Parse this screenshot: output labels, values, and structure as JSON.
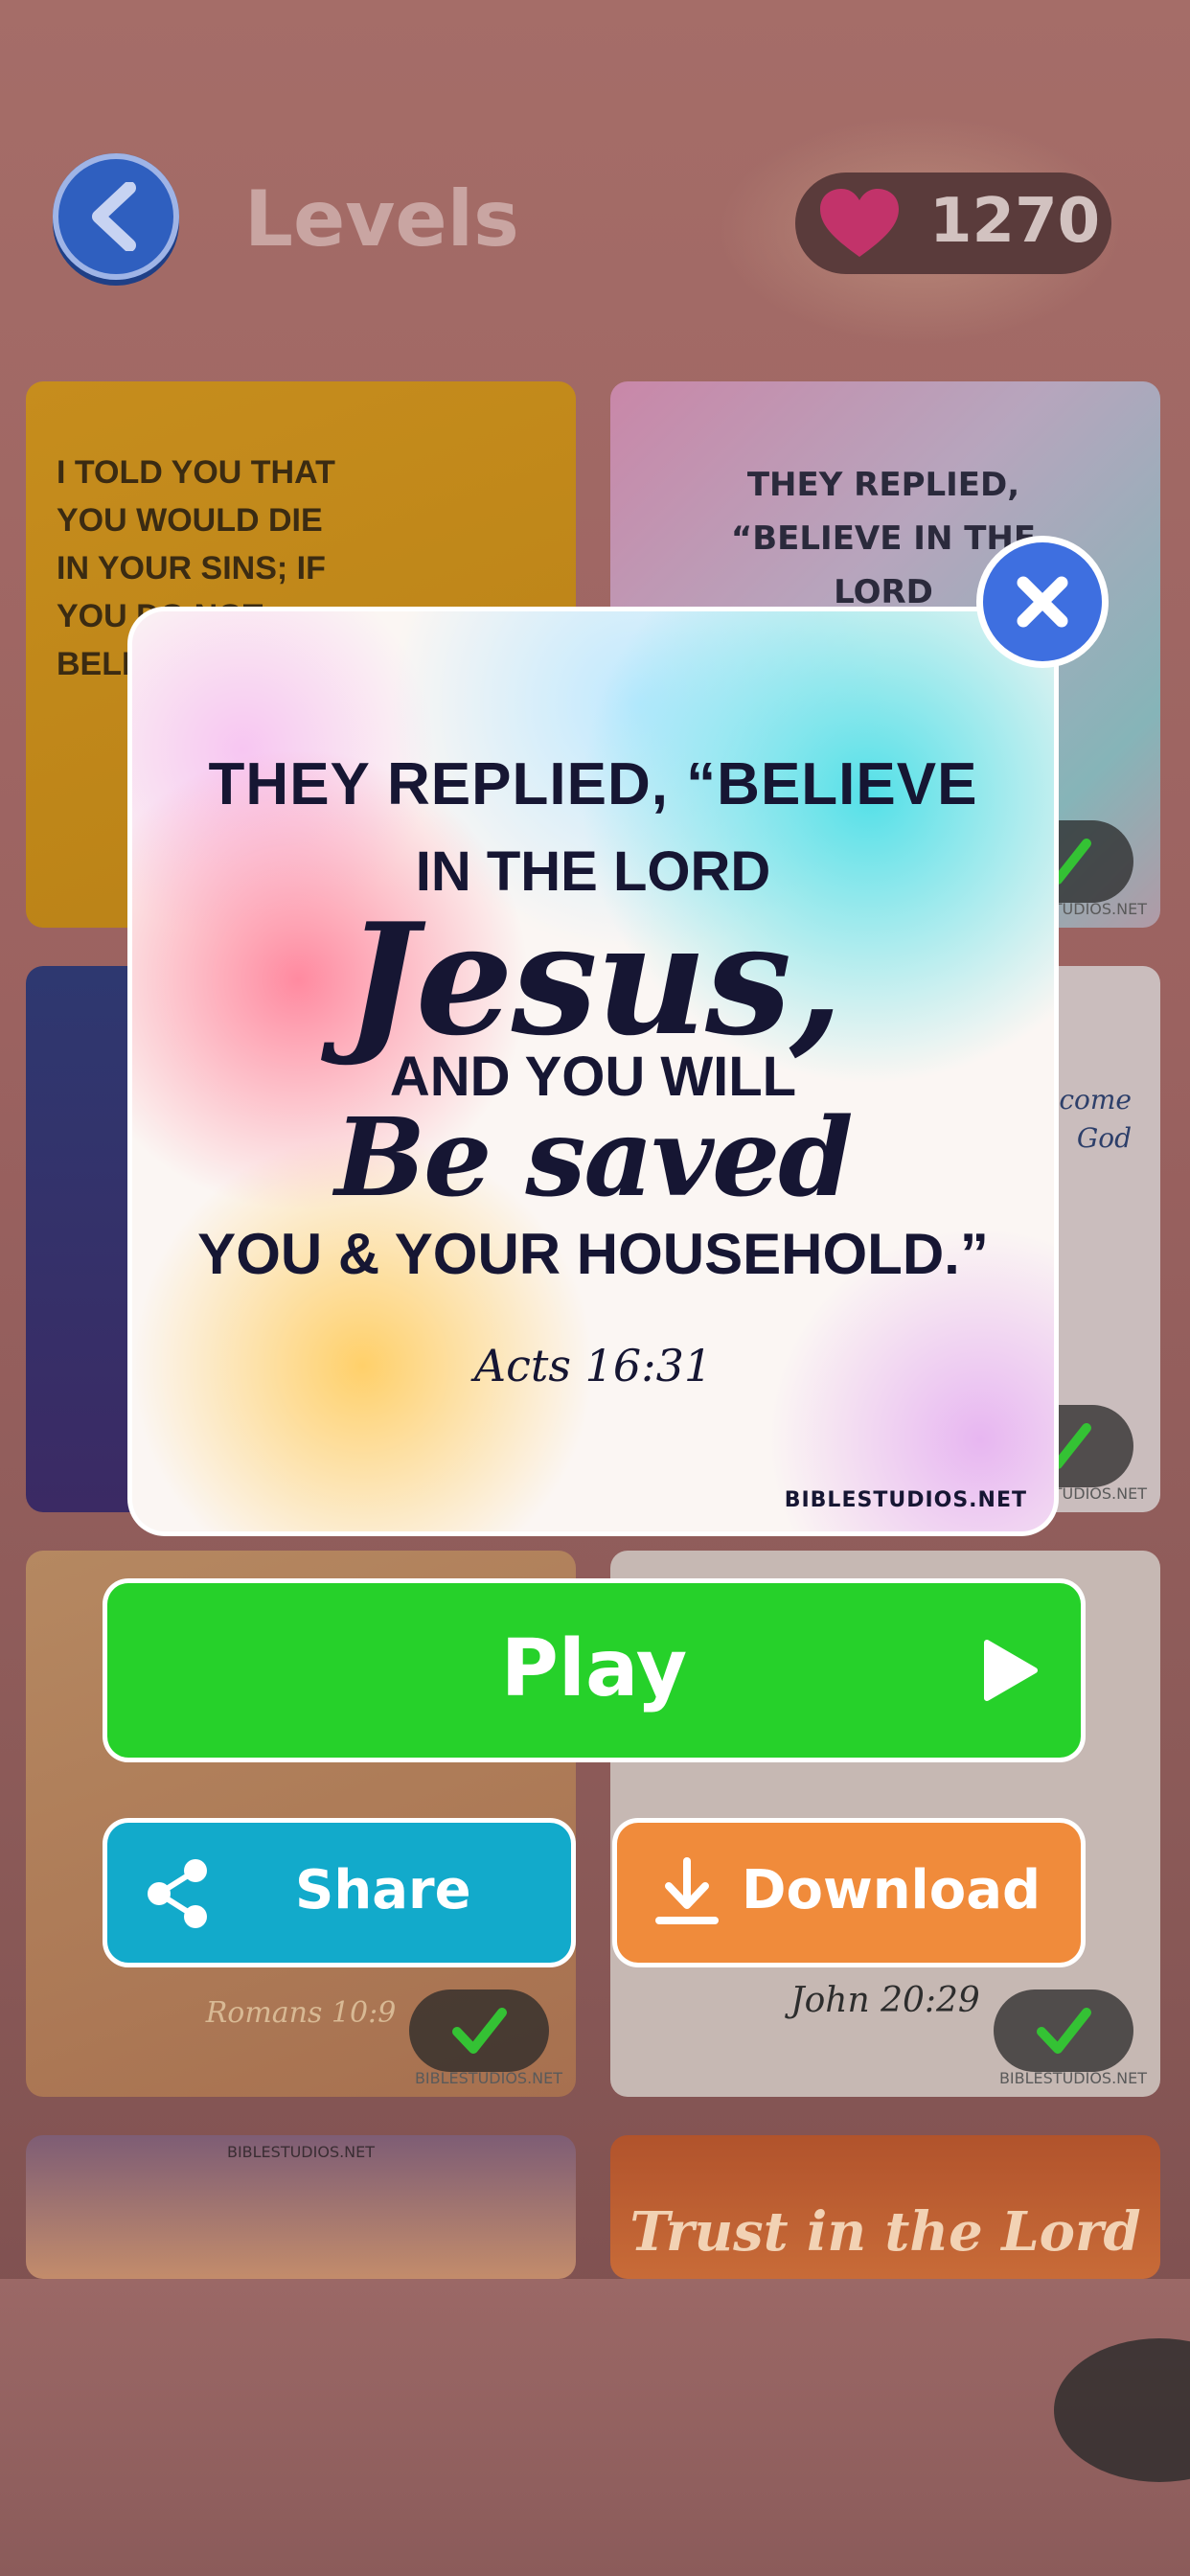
{
  "header": {
    "title": "Levels",
    "hearts": "1270"
  },
  "tiles": [
    {
      "text": "I TOLD YOU THAT YOU WOULD DIE IN YOUR SINS; IF YOU DO NOT BELIEVE THAT"
    },
    {
      "text": "THEY REPLIED, “BELIEVE IN THE LORD",
      "watermark": "STUDIOS.NET"
    },
    {
      "text": ""
    },
    {
      "text": "who did to those in his ive the come God",
      "watermark": "STUDIOS.NET"
    },
    {
      "text": "Romans 10:9",
      "watermark": "BIBLESTUDIOS.NET"
    },
    {
      "text": "John 20:29",
      "watermark": "BIBLESTUDIOS.NET"
    },
    {
      "watermark": "BIBLESTUDIOS.NET"
    },
    {
      "text": "Trust in the Lord"
    }
  ],
  "modal": {
    "line1": "THEY REPLIED, “BELIEVE",
    "line2": "IN THE LORD",
    "line3": "Jesus,",
    "line4": "AND YOU WILL",
    "line5": "Be saved",
    "line6": "YOU & YOUR HOUSEHOLD.”",
    "reference": "Acts 16:31",
    "site": "BIBLESTUDIOS.NET"
  },
  "actions": {
    "play": "Play",
    "share": "Share",
    "download": "Download"
  },
  "colors": {
    "play": "#26d12a",
    "share": "#12aacb",
    "download": "#f08b3b",
    "close": "#3e6fe0",
    "back": "#2f5fbf"
  }
}
